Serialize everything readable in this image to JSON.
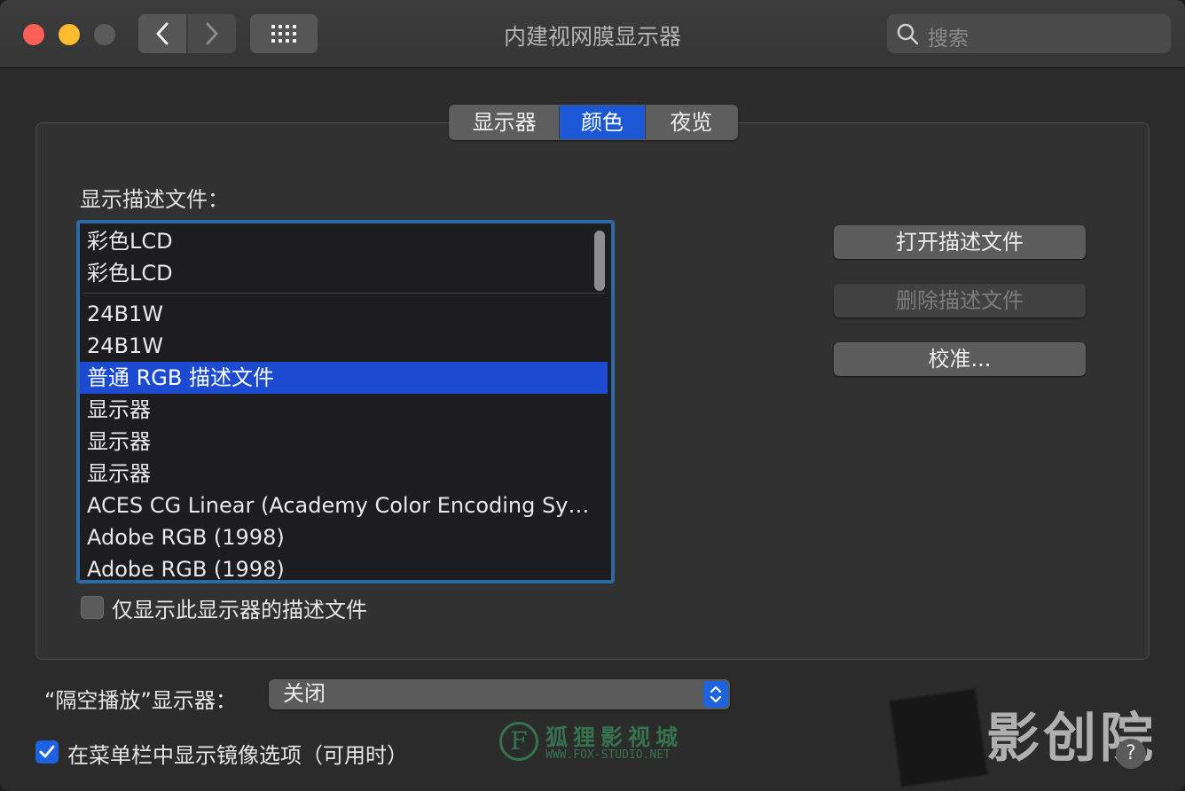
{
  "window": {
    "title": "内建视网膜显示器",
    "search_placeholder": "搜索"
  },
  "tabs": [
    {
      "label": "显示器",
      "selected": false
    },
    {
      "label": "颜色",
      "selected": true
    },
    {
      "label": "夜览",
      "selected": false
    }
  ],
  "profiles": {
    "label": "显示描述文件：",
    "items": [
      "彩色LCD",
      "彩色LCD",
      "24B1W",
      "24B1W",
      "普通 RGB 描述文件",
      "显示器",
      "显示器",
      "显示器",
      "ACES CG Linear (Academy Color Encoding Sy…",
      "Adobe RGB (1998)",
      "Adobe RGB (1998)"
    ],
    "selected_index": 4,
    "only_this_display_label": "仅显示此显示器的描述文件",
    "only_this_display_checked": false
  },
  "buttons": {
    "open_profile": "打开描述文件",
    "delete_profile": "删除描述文件",
    "calibrate": "校准..."
  },
  "airplay": {
    "label": "“隔空播放”显示器：",
    "value": "关闭"
  },
  "menubar_option": {
    "label": "在菜单栏中显示镜像选项（可用时）",
    "checked": true
  },
  "help": "?",
  "watermarks": {
    "fox_letter": "F",
    "fox_cn": "狐狸影视城",
    "fox_url": "WWW.FOX-STUDIO.NET",
    "studio": "影创院"
  },
  "colors": {
    "accent": "#1c57d6",
    "selection": "#1c4ad1",
    "focus_ring": "#2d6aa5"
  }
}
